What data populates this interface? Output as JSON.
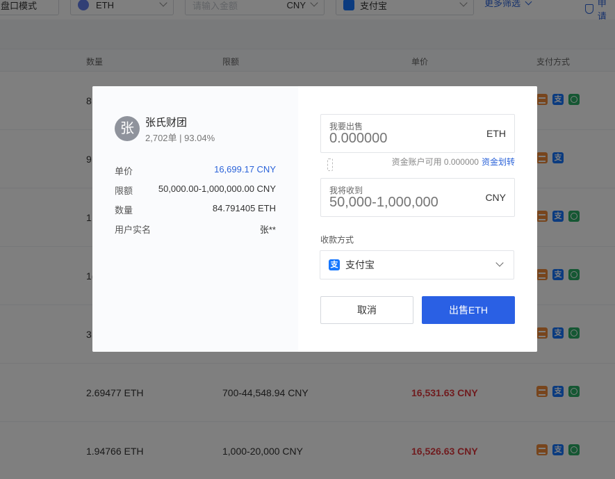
{
  "filters": {
    "mode_label": "盘口模式",
    "coin": "ETH",
    "amount_placeholder": "请输入金额",
    "amount_currency": "CNY",
    "payment": "支付宝",
    "more_filter": "更多筛选",
    "apply": "申请"
  },
  "table": {
    "headers": {
      "qty": "数量",
      "limit": "限额",
      "price": "单价",
      "pay": "支付方式"
    },
    "rows": [
      {
        "qty_partial": "8",
        "pays": [
          "bank",
          "alipay",
          "wechat"
        ]
      },
      {
        "qty_partial": "9",
        "pays": [
          "bank",
          "alipay"
        ]
      },
      {
        "qty_partial": "1",
        "pays": [
          "bank",
          "alipay",
          "wechat"
        ]
      },
      {
        "qty_partial": "1(",
        "pays": [
          "bank",
          "alipay",
          "wechat"
        ]
      },
      {
        "qty_partial": "3",
        "pays": [
          "bank",
          "alipay",
          "wechat"
        ]
      },
      {
        "qty": "2.69477 ETH",
        "limit": "700-44,548.94 CNY",
        "price": "16,531.63 CNY",
        "pays": [
          "bank",
          "alipay",
          "wechat"
        ]
      },
      {
        "qty": "1.94766 ETH",
        "limit": "1,000-20,000 CNY",
        "price": "16,526.63 CNY",
        "pays": [
          "bank",
          "alipay",
          "wechat"
        ]
      }
    ]
  },
  "modal": {
    "merchant": {
      "avatar_char": "张",
      "name": "张氏财团",
      "stats": "2,702单 | 93.04%"
    },
    "info": {
      "price_label": "单价",
      "price_value": "16,699.17 CNY",
      "limit_label": "限额",
      "limit_value": "50,000.00-1,000,000.00 CNY",
      "qty_label": "数量",
      "qty_value": "84.791405 ETH",
      "realname_label": "用户实名",
      "realname_value": "张**"
    },
    "sell_field": {
      "label": "我要出售",
      "placeholder": "0.000000",
      "unit": "ETH"
    },
    "available": {
      "text": "资金账户可用 0.000000",
      "link": "资金划转"
    },
    "receive_field": {
      "label": "我将收到",
      "placeholder": "50,000-1,000,000",
      "unit": "CNY"
    },
    "payment_method": {
      "label": "收款方式",
      "selected": "支付宝",
      "icon_glyph": "支"
    },
    "buttons": {
      "cancel": "取消",
      "sell": "出售ETH"
    }
  },
  "colors": {
    "accent": "#2a60e4",
    "link": "#2b63d9",
    "price_red": "#e0393e",
    "overlay": "rgba(0,0,0,0.5)"
  }
}
